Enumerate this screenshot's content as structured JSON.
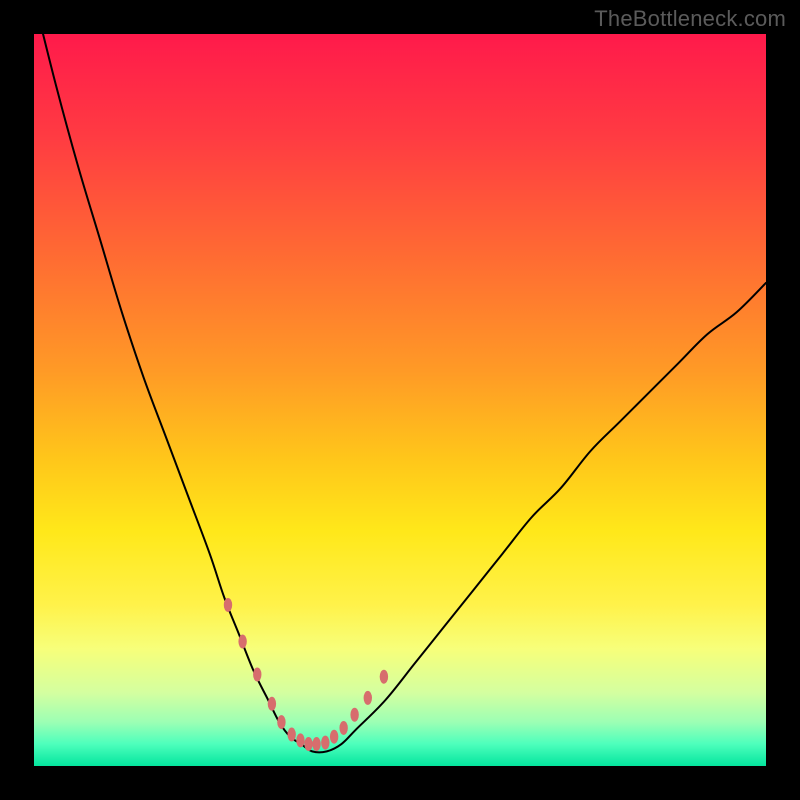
{
  "watermark": {
    "text": "TheBottleneck.com"
  },
  "chart_data": {
    "type": "line",
    "title": "",
    "xlabel": "",
    "ylabel": "",
    "xlim": [
      0,
      100
    ],
    "ylim": [
      0,
      100
    ],
    "gradient": {
      "stops": [
        {
          "pct": 0,
          "color": "#ff1a4b"
        },
        {
          "pct": 14,
          "color": "#ff3b42"
        },
        {
          "pct": 30,
          "color": "#ff6a33"
        },
        {
          "pct": 46,
          "color": "#ff9a26"
        },
        {
          "pct": 58,
          "color": "#ffc61a"
        },
        {
          "pct": 68,
          "color": "#ffe81a"
        },
        {
          "pct": 78,
          "color": "#fff24a"
        },
        {
          "pct": 84,
          "color": "#f7ff7a"
        },
        {
          "pct": 90,
          "color": "#d4ffa0"
        },
        {
          "pct": 94,
          "color": "#9cffb4"
        },
        {
          "pct": 97,
          "color": "#4dffbc"
        },
        {
          "pct": 100,
          "color": "#04e59e"
        }
      ]
    },
    "series": [
      {
        "name": "bottleneck-curve",
        "stroke": "#000000",
        "stroke_width": 2,
        "x": [
          0,
          3,
          6,
          9,
          12,
          15,
          18,
          21,
          24,
          26,
          28,
          30,
          32,
          33.5,
          35,
          36.5,
          38,
          40,
          42,
          44,
          48,
          52,
          56,
          60,
          64,
          68,
          72,
          76,
          80,
          84,
          88,
          92,
          96,
          100
        ],
        "y": [
          105,
          93,
          82,
          72,
          62,
          53,
          45,
          37,
          29,
          23,
          18,
          13,
          9,
          6,
          4,
          3,
          2,
          2,
          3,
          5,
          9,
          14,
          19,
          24,
          29,
          34,
          38,
          43,
          47,
          51,
          55,
          59,
          62,
          66
        ]
      },
      {
        "name": "samples-left",
        "type": "scatter",
        "color": "#d76d6d",
        "marker_rx": 4.2,
        "marker_ry": 7,
        "x": [
          26.5,
          28.5,
          30.5,
          32.5,
          33.8,
          35.2,
          36.4,
          37.5,
          38.6
        ],
        "y": [
          22,
          17,
          12.5,
          8.5,
          6,
          4.3,
          3.5,
          3.0,
          3.0
        ]
      },
      {
        "name": "samples-right",
        "type": "scatter",
        "color": "#d76d6d",
        "marker_rx": 4.2,
        "marker_ry": 7,
        "x": [
          39.8,
          41.0,
          42.3,
          43.8,
          45.6,
          47.8
        ],
        "y": [
          3.2,
          4.0,
          5.2,
          7.0,
          9.3,
          12.2
        ]
      }
    ]
  }
}
